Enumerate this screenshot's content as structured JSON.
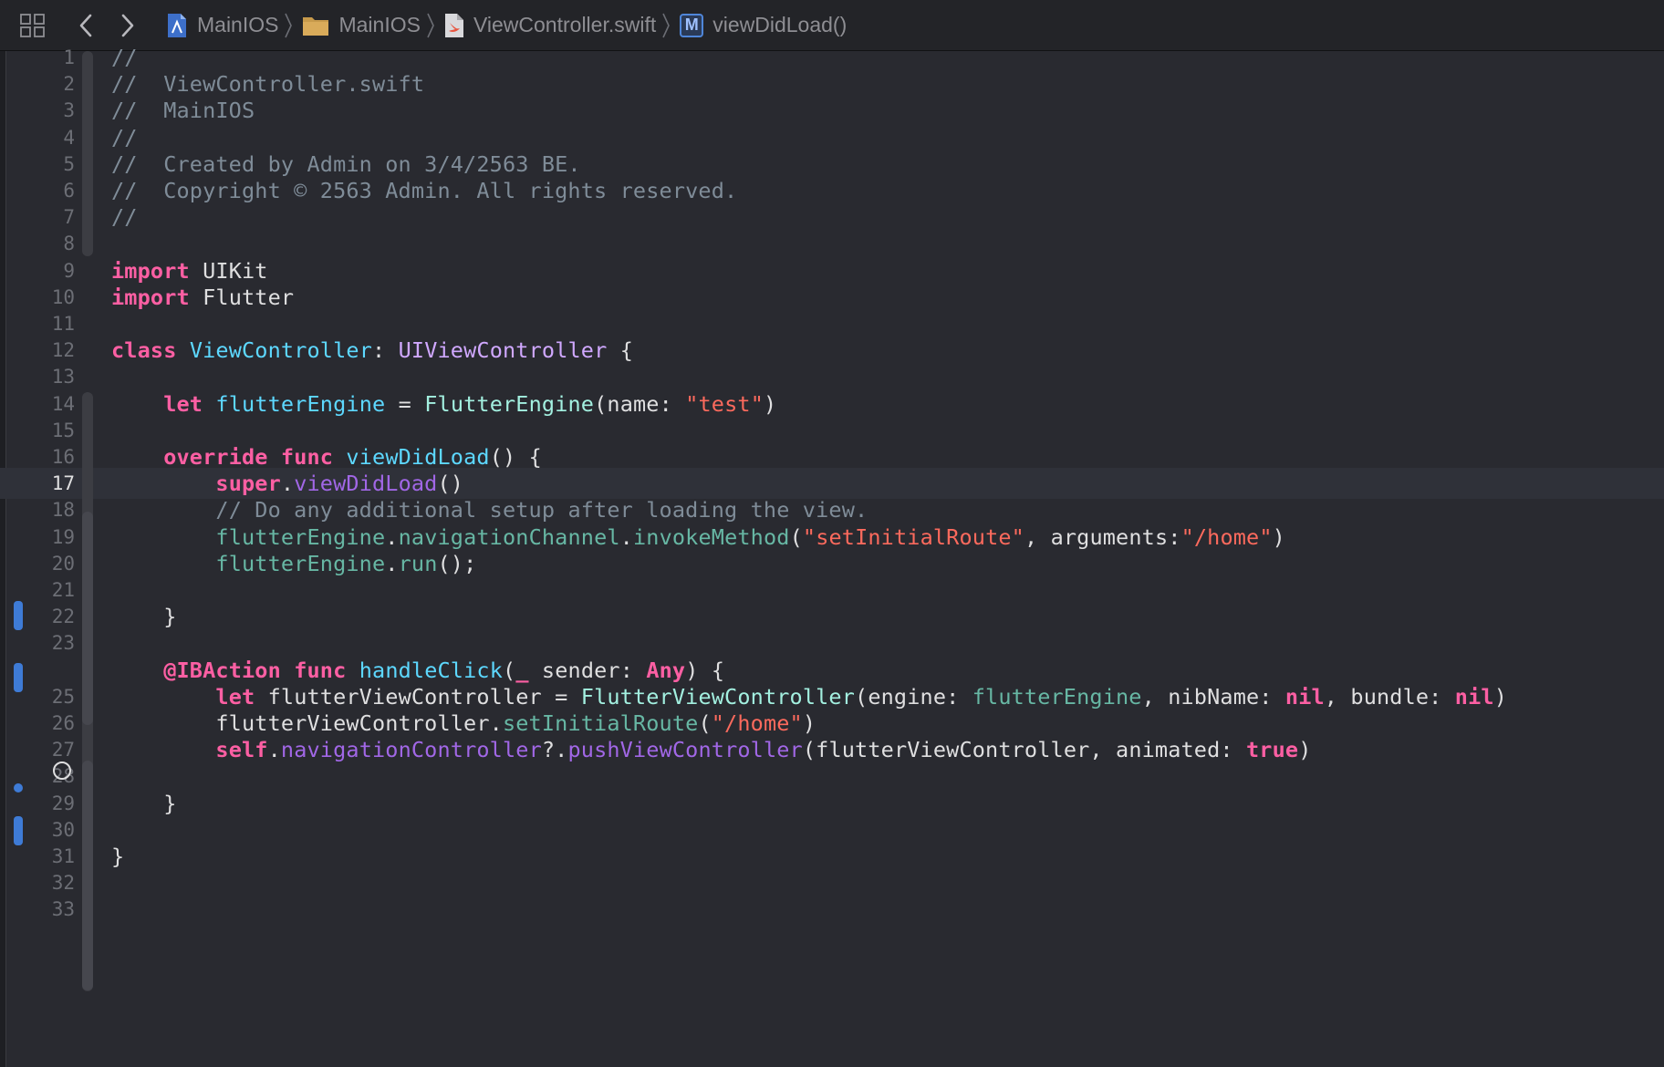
{
  "jumpbar": {
    "crumbs": [
      {
        "label": "MainIOS",
        "icon": "project-icon"
      },
      {
        "label": "MainIOS",
        "icon": "folder-icon"
      },
      {
        "label": "ViewController.swift",
        "icon": "swift-file-icon"
      },
      {
        "label": "viewDidLoad()",
        "icon": "method-icon",
        "badge": "M"
      }
    ]
  },
  "editor": {
    "current_line": 17,
    "lines": [
      {
        "n": "1",
        "tokens": [
          [
            "cm",
            "//"
          ]
        ]
      },
      {
        "n": "2",
        "tokens": [
          [
            "cm",
            "//  ViewController.swift"
          ]
        ]
      },
      {
        "n": "3",
        "tokens": [
          [
            "cm",
            "//  MainIOS"
          ]
        ]
      },
      {
        "n": "4",
        "tokens": [
          [
            "cm",
            "//"
          ]
        ]
      },
      {
        "n": "5",
        "tokens": [
          [
            "cm",
            "//  Created by Admin on 3/4/2563 BE."
          ]
        ]
      },
      {
        "n": "6",
        "tokens": [
          [
            "cm",
            "//  Copyright © 2563 Admin. All rights reserved."
          ]
        ]
      },
      {
        "n": "7",
        "tokens": [
          [
            "cm",
            "//"
          ]
        ]
      },
      {
        "n": "8",
        "tokens": []
      },
      {
        "n": "9",
        "tokens": [
          [
            "kw",
            "import"
          ],
          [
            "nm",
            " UIKit"
          ]
        ]
      },
      {
        "n": "10",
        "tokens": [
          [
            "kw",
            "import"
          ],
          [
            "nm",
            " Flutter"
          ]
        ]
      },
      {
        "n": "11",
        "tokens": []
      },
      {
        "n": "12",
        "tokens": [
          [
            "kw",
            "class"
          ],
          [
            "nm",
            " "
          ],
          [
            "td",
            "ViewController"
          ],
          [
            "nm",
            ": "
          ],
          [
            "tp",
            "UIViewController"
          ],
          [
            "nm",
            " {"
          ]
        ]
      },
      {
        "n": "13",
        "tokens": []
      },
      {
        "n": "14",
        "tokens": [
          [
            "nm",
            "    "
          ],
          [
            "kw",
            "let"
          ],
          [
            "nm",
            " "
          ],
          [
            "td",
            "flutterEngine"
          ],
          [
            "nm",
            " = "
          ],
          [
            "pf",
            "FlutterEngine"
          ],
          [
            "nm",
            "(name: "
          ],
          [
            "st",
            "\"test\""
          ],
          [
            "nm",
            ")"
          ]
        ]
      },
      {
        "n": "15",
        "tokens": []
      },
      {
        "n": "16",
        "tokens": [
          [
            "nm",
            "    "
          ],
          [
            "kw",
            "override"
          ],
          [
            "nm",
            " "
          ],
          [
            "kw",
            "func"
          ],
          [
            "nm",
            " "
          ],
          [
            "td",
            "viewDidLoad"
          ],
          [
            "nm",
            "() {"
          ]
        ]
      },
      {
        "n": "17",
        "tokens": [
          [
            "nm",
            "        "
          ],
          [
            "kw",
            "super"
          ],
          [
            "nm",
            "."
          ],
          [
            "pj",
            "viewDidLoad"
          ],
          [
            "nm",
            "()"
          ]
        ]
      },
      {
        "n": "18",
        "tokens": [
          [
            "nm",
            "        "
          ],
          [
            "cm",
            "// Do any additional setup after loading the view."
          ]
        ]
      },
      {
        "n": "19",
        "tokens": [
          [
            "nm",
            "        "
          ],
          [
            "pv",
            "flutterEngine"
          ],
          [
            "nm",
            "."
          ],
          [
            "pv",
            "navigationChannel"
          ],
          [
            "nm",
            "."
          ],
          [
            "pv",
            "invokeMethod"
          ],
          [
            "nm",
            "("
          ],
          [
            "st",
            "\"setInitialRoute\""
          ],
          [
            "nm",
            ", arguments:"
          ],
          [
            "st",
            "\"/home\""
          ],
          [
            "nm",
            ")"
          ]
        ]
      },
      {
        "n": "20",
        "tokens": [
          [
            "nm",
            "        "
          ],
          [
            "pv",
            "flutterEngine"
          ],
          [
            "nm",
            "."
          ],
          [
            "pv",
            "run"
          ],
          [
            "nm",
            "();"
          ]
        ]
      },
      {
        "n": "21",
        "tokens": []
      },
      {
        "n": "22",
        "tokens": [
          [
            "nm",
            "    }"
          ]
        ]
      },
      {
        "n": "23",
        "tokens": []
      },
      {
        "n": "",
        "tokens": [
          [
            "nm",
            "    "
          ],
          [
            "kw",
            "@IBAction"
          ],
          [
            "nm",
            " "
          ],
          [
            "kw",
            "func"
          ],
          [
            "nm",
            " "
          ],
          [
            "td",
            "handleClick"
          ],
          [
            "nm",
            "("
          ],
          [
            "kw",
            "_"
          ],
          [
            "nm",
            " sender: "
          ],
          [
            "kw",
            "Any"
          ],
          [
            "nm",
            ") {"
          ]
        ]
      },
      {
        "n": "25",
        "tokens": [
          [
            "nm",
            "        "
          ],
          [
            "kw",
            "let"
          ],
          [
            "nm",
            " flutterViewController = "
          ],
          [
            "pf",
            "FlutterViewController"
          ],
          [
            "nm",
            "(engine: "
          ],
          [
            "pv",
            "flutterEngine"
          ],
          [
            "nm",
            ", nibName: "
          ],
          [
            "kw",
            "nil"
          ],
          [
            "nm",
            ", bundle: "
          ],
          [
            "kw",
            "nil"
          ],
          [
            "nm",
            ")"
          ]
        ]
      },
      {
        "n": "26",
        "tokens": [
          [
            "nm",
            "        flutterViewController."
          ],
          [
            "pv",
            "setInitialRoute"
          ],
          [
            "nm",
            "("
          ],
          [
            "st",
            "\"/home\""
          ],
          [
            "nm",
            ")"
          ]
        ]
      },
      {
        "n": "27",
        "tokens": [
          [
            "nm",
            "        "
          ],
          [
            "kw",
            "self"
          ],
          [
            "nm",
            "."
          ],
          [
            "pj",
            "navigationController"
          ],
          [
            "nm",
            "?."
          ],
          [
            "pj",
            "pushViewController"
          ],
          [
            "nm",
            "(flutterViewController, animated: "
          ],
          [
            "kw",
            "true"
          ],
          [
            "nm",
            ")"
          ]
        ]
      },
      {
        "n": "28",
        "tokens": []
      },
      {
        "n": "29",
        "tokens": [
          [
            "nm",
            "    }"
          ]
        ]
      },
      {
        "n": "30",
        "tokens": []
      },
      {
        "n": "31",
        "tokens": [
          [
            "nm",
            "}"
          ]
        ]
      },
      {
        "n": "32",
        "tokens": []
      },
      {
        "n": "33",
        "tokens": []
      }
    ]
  },
  "colors": {
    "background": "#292a30",
    "keyword": "#fc5fa3",
    "comment": "#7f8c98",
    "string": "#fc6a5d",
    "type_declaration": "#5dd8ff",
    "other_type": "#d0a8ff",
    "change_bar": "#3e7bd6"
  }
}
